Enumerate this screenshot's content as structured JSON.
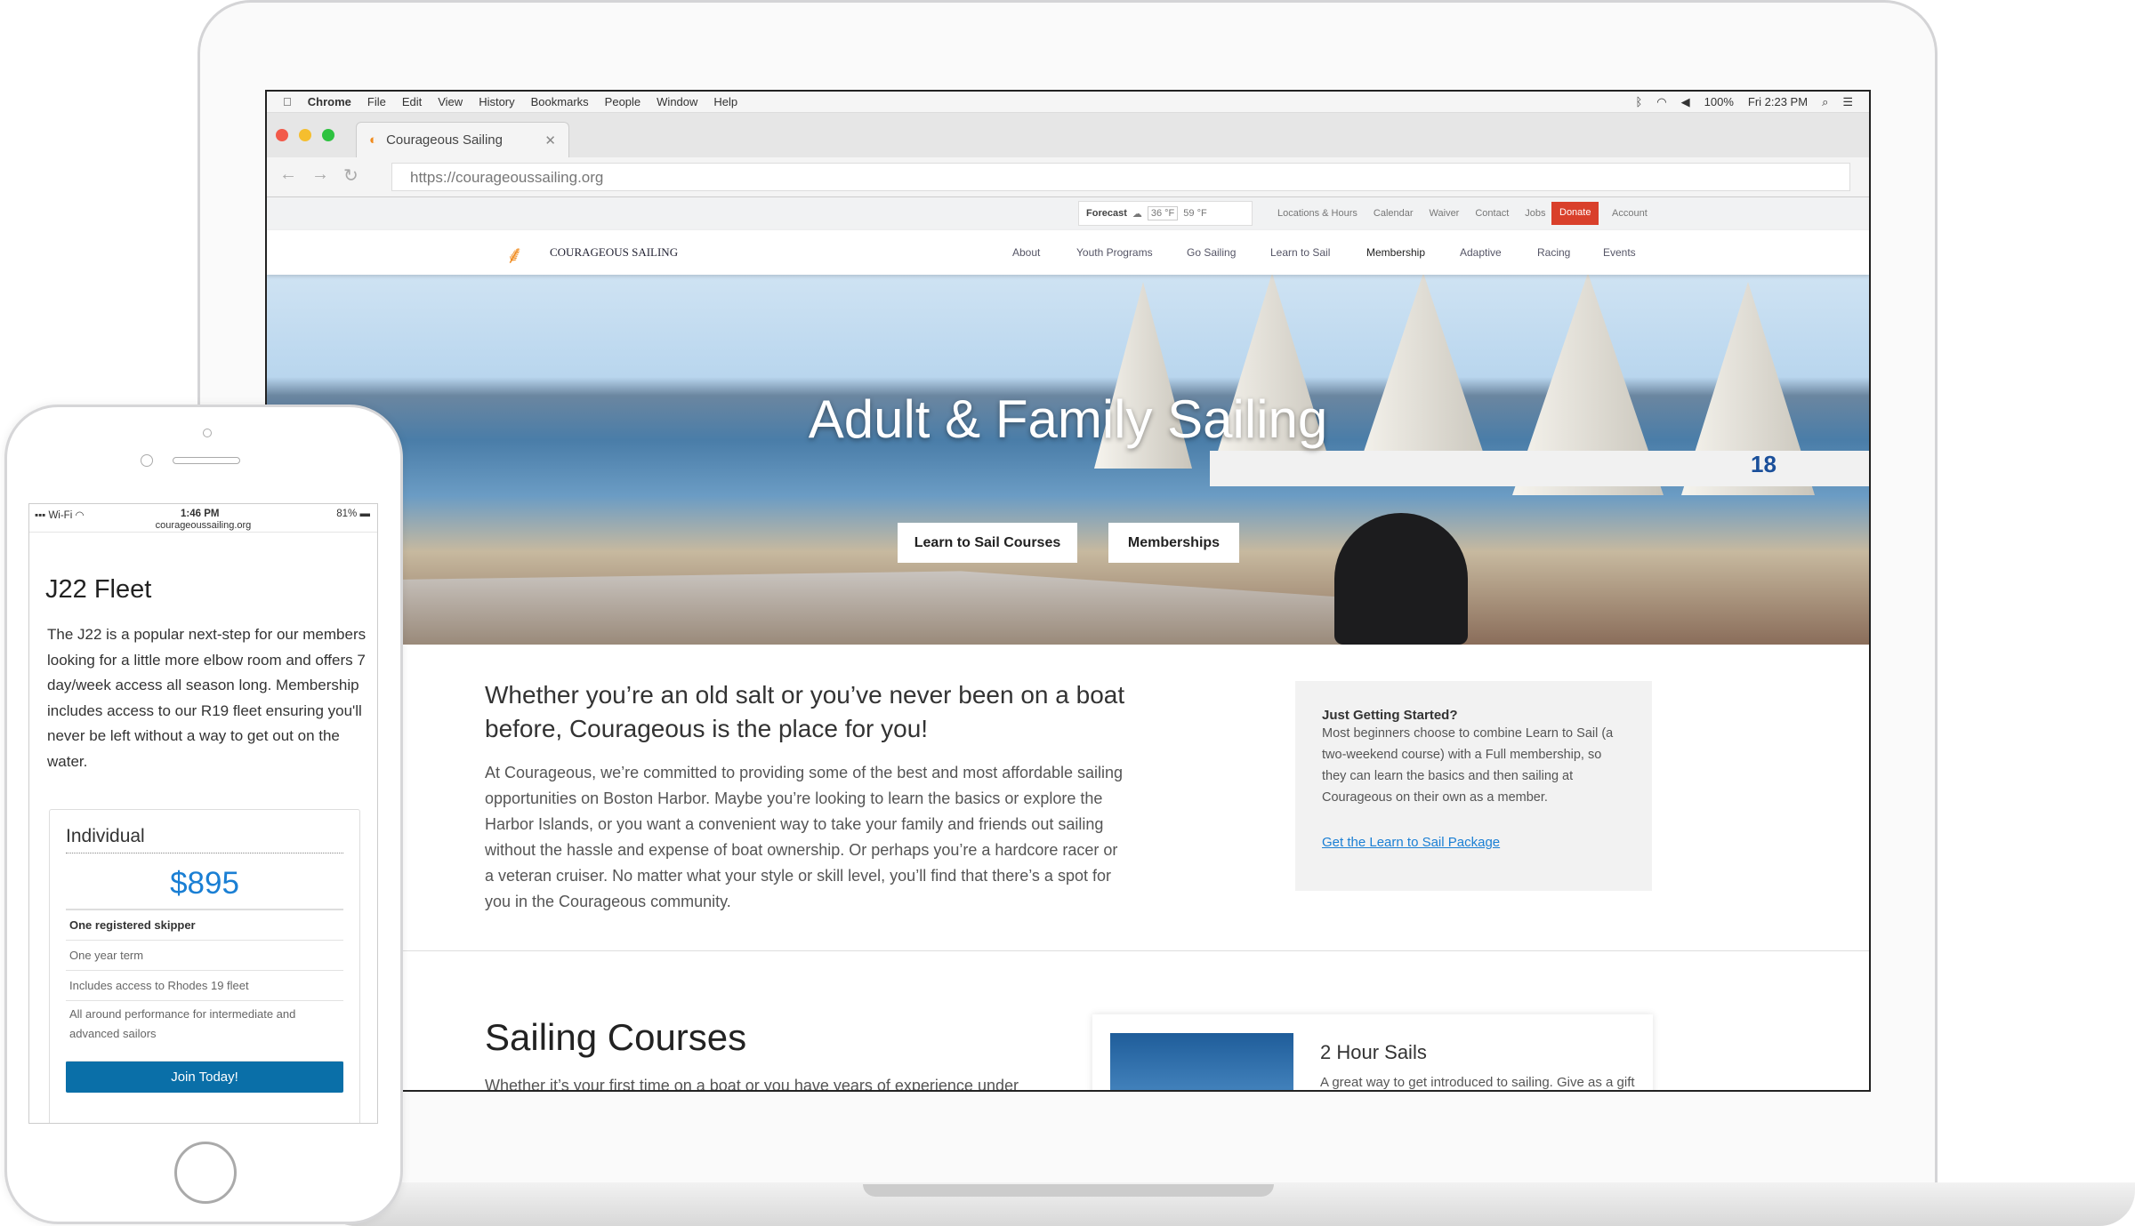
{
  "menubar": {
    "app": "Chrome",
    "items": [
      "File",
      "Edit",
      "View",
      "History",
      "Bookmarks",
      "People",
      "Window",
      "Help"
    ],
    "battery": "100%",
    "clock": "Fri 2:23 PM"
  },
  "tab": {
    "title": "Courageous Sailing"
  },
  "address": {
    "url": "https://courageoussailing.org"
  },
  "utility": {
    "forecast": "Forecast",
    "temp_low": "36 °F",
    "temp_high": "59 °F",
    "links": [
      "Locations & Hours",
      "Calendar",
      "Waiver",
      "Contact",
      "Jobs"
    ],
    "donate": "Donate",
    "account": "Account"
  },
  "nav": {
    "logo": "COURAGEOUS SAILING",
    "items": [
      "About",
      "Youth Programs",
      "Go Sailing",
      "Learn to Sail",
      "Membership",
      "Adaptive",
      "Racing",
      "Events"
    ]
  },
  "hero": {
    "title": "Adult & Family Sailing",
    "btn1": "Learn to Sail Courses",
    "btn2": "Memberships",
    "boat_number": "18"
  },
  "intro": {
    "heading": "Whether you’re an old salt or you’ve never been on a boat before, Courageous is the place for you!",
    "body": "At Courageous, we’re committed to providing some of the best and most affordable sailing opportunities on Boston Harbor. Maybe you’re looking to learn the basics or explore the Harbor Islands, or you want a convenient way to take your family and friends out sailing without the hassle and expense of boat ownership. Or perhaps you’re a hardcore racer or a veteran cruiser. No matter what your style or skill level, you’ll find that there’s a spot for you in the Courageous community."
  },
  "sidebar": {
    "title": "Just Getting Started?",
    "body": "Most beginners choose to combine Learn to Sail (a two-weekend course) with a Full membership, so they can learn the basics and then sailing at Courageous on their own as a member.",
    "link": "Get the Learn to Sail Package"
  },
  "courses": {
    "heading": "Sailing Courses",
    "body": "Whether it’s your first time on a boat or you have years of experience under",
    "card_title": "2 Hour Sails",
    "card_body": "A great way to get introduced to sailing. Give as a gift"
  },
  "phone": {
    "carrier": "Wi-Fi",
    "time": "1:46 PM",
    "battery": "81%",
    "url": "courageoussailing.org",
    "title": "J22 Fleet",
    "body": "The J22 is a popular next-step for our members looking for a little more elbow room and offers 7 day/week access all season long. Membership includes access to our R19 fleet ensuring you'll never be left without a way to get out on the water.",
    "plan": "Individual",
    "price": "$895",
    "features": [
      "One registered skipper",
      "One year term",
      "Includes access to Rhodes 19 fleet",
      "All around performance for intermediate and advanced sailors"
    ],
    "cta": "Join Today!"
  },
  "colors": {
    "accent": "#1a7fd4",
    "donate": "#d9402b",
    "button": "#0a6fa8"
  }
}
